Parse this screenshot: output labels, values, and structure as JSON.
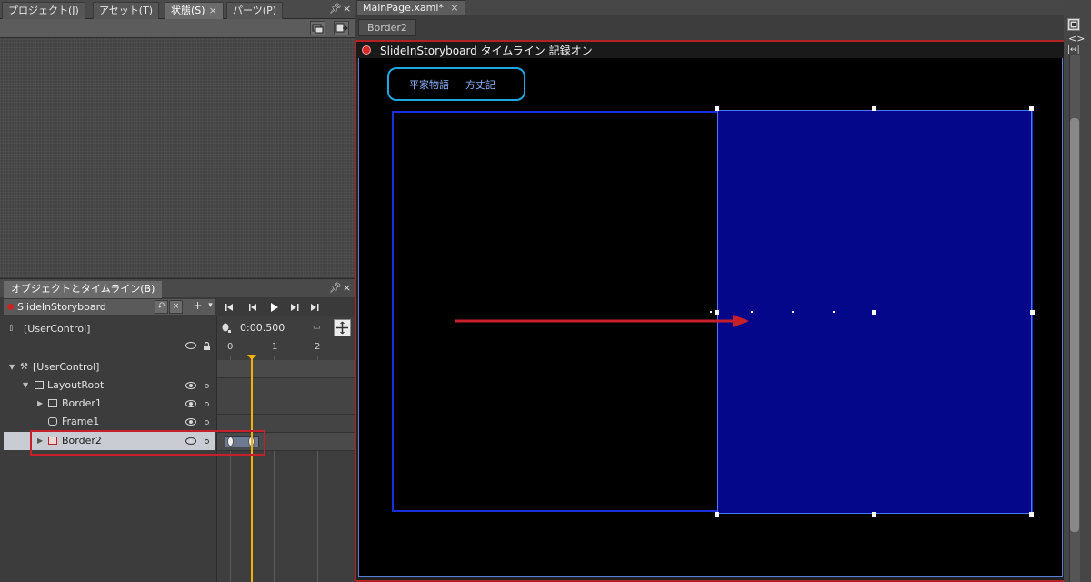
{
  "left_panel": {
    "tabs": [
      {
        "label": "プロジェクト(J)",
        "active": false
      },
      {
        "label": "アセット(T)",
        "active": false
      },
      {
        "label": "状態(S)",
        "active": true,
        "close": "×"
      },
      {
        "label": "パーツ(P)",
        "active": false
      }
    ],
    "pin_glyph": "▾",
    "close_glyph": "×"
  },
  "objects_panel": {
    "title": "オブジェクトとタイムライン(B)",
    "storyboard_name": "SlideInStoryboard",
    "add_glyph": "+",
    "scope_label": "[UserControl]",
    "time_display": "0:00.500",
    "ruler_ticks": [
      "0",
      "1",
      "2"
    ],
    "tree": [
      {
        "label": "[UserControl]",
        "depth": 0,
        "icon": "usercontrol-icon"
      },
      {
        "label": "LayoutRoot",
        "depth": 1,
        "icon": "grid-icon"
      },
      {
        "label": "Border1",
        "depth": 2,
        "icon": "border-icon"
      },
      {
        "label": "Frame1",
        "depth": 2,
        "icon": "frame-icon"
      },
      {
        "label": "Border2",
        "depth": 2,
        "icon": "border-icon",
        "selected": true
      }
    ]
  },
  "editor": {
    "doc_tab": "MainPage.xaml*",
    "doc_tab_close": "×",
    "breadcrumb": "Border2",
    "recording_text": "SlideInStoryboard タイムライン 記録オン",
    "nav_links": [
      "平家物語",
      "方丈記"
    ]
  },
  "colors": {
    "record_red": "#d42b2b",
    "selection_red": "#c8202a",
    "border2_fill": "#05078a",
    "pill_border": "#1fa6e0",
    "playhead": "#f0b400"
  }
}
